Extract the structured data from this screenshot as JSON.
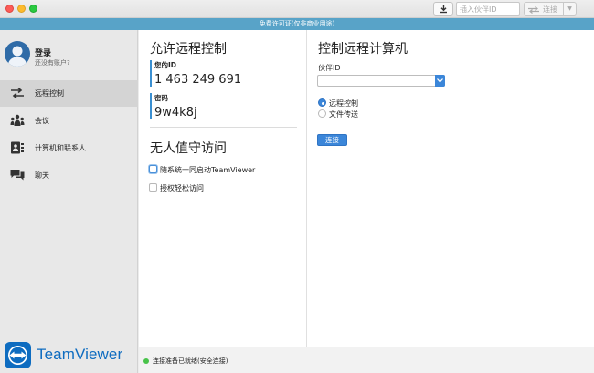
{
  "titlebar": {
    "partner_id_placeholder": "插入伙伴ID",
    "connect_label": "连接"
  },
  "banner": {
    "text": "免费许可证(仅非商业用途)"
  },
  "sidebar": {
    "login_title": "登录",
    "login_sub": "还没有账户?",
    "items": [
      {
        "label": "远程控制",
        "icon": "arrows-icon",
        "active": true
      },
      {
        "label": "会议",
        "icon": "meeting-icon",
        "active": false
      },
      {
        "label": "计算机和联系人",
        "icon": "contacts-icon",
        "active": false
      },
      {
        "label": "聊天",
        "icon": "chat-icon",
        "active": false
      }
    ],
    "logo_text": "TeamViewer"
  },
  "allow": {
    "heading": "允许远程控制",
    "your_id_label": "您的ID",
    "your_id_value": "1 463 249 691",
    "password_label": "密码",
    "password_value": "9w4k8j"
  },
  "unattended": {
    "heading": "无人值守访问",
    "start_with_system": "随系统一同启动TeamViewer",
    "grant_easy_access": "授权轻松访问"
  },
  "control": {
    "heading": "控制远程计算机",
    "partner_id_label": "伙伴ID",
    "radio_remote": "远程控制",
    "radio_file": "文件传送",
    "connect_button": "连接"
  },
  "status": {
    "text": "连接准备已就绪(安全连接)"
  },
  "colors": {
    "accent": "#3b86d9",
    "banner": "#58a3c8",
    "brand": "#0e6cc0",
    "status_ok": "#48c34a"
  }
}
